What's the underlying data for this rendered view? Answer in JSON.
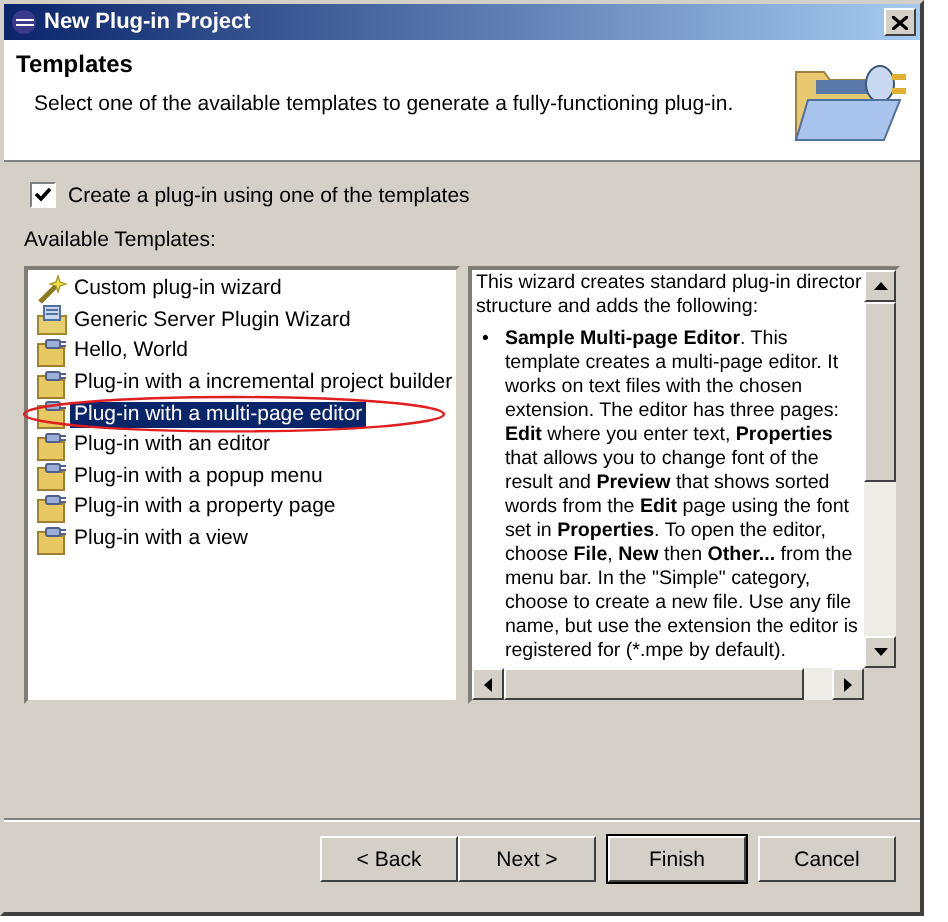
{
  "window": {
    "title": "New Plug-in Project"
  },
  "header": {
    "title": "Templates",
    "description": "Select one of the available templates to generate a fully-functioning plug-in."
  },
  "use_templates": {
    "label": "Create a plug-in using one of the templates",
    "checked": true
  },
  "templates_label": "Available Templates:",
  "templates": [
    {
      "label": "Custom plug-in wizard",
      "kind": "wizard",
      "selected": false
    },
    {
      "label": "Generic Server Plugin Wizard",
      "kind": "server",
      "selected": false
    },
    {
      "label": "Hello, World",
      "kind": "plugin",
      "selected": false
    },
    {
      "label": "Plug-in with a incremental project builder",
      "kind": "plugin",
      "selected": false
    },
    {
      "label": "Plug-in with a multi-page editor",
      "kind": "plugin",
      "selected": true
    },
    {
      "label": "Plug-in with an editor",
      "kind": "plugin",
      "selected": false
    },
    {
      "label": "Plug-in with a popup menu",
      "kind": "plugin",
      "selected": false
    },
    {
      "label": "Plug-in with a property page",
      "kind": "plugin",
      "selected": false
    },
    {
      "label": "Plug-in with a view",
      "kind": "plugin",
      "selected": false
    }
  ],
  "description": {
    "intro": "This wizard creates standard plug-in director structure and adds the following:",
    "bullet": "•",
    "item": "**Sample Multi-page Editor**. This template creates a multi-page editor. It works on text files with the chosen extension. The editor has three pages: **Edit** where you enter text, **Properties** that allows you to change font of the result and **Preview** that shows sorted words from the **Edit** page using the font set in **Properties**. To open the editor, choose **File**, **New** then **Other...** from the menu bar. In the \"Simple\" category, choose to create a new file. Use any file name, but use the extension the editor is registered for (*.mpe by default)."
  },
  "buttons": [
    {
      "label": "< Back",
      "default": false
    },
    {
      "label": "Next >",
      "default": false
    },
    {
      "label": "Finish",
      "default": true
    },
    {
      "label": "Cancel",
      "default": false
    }
  ]
}
